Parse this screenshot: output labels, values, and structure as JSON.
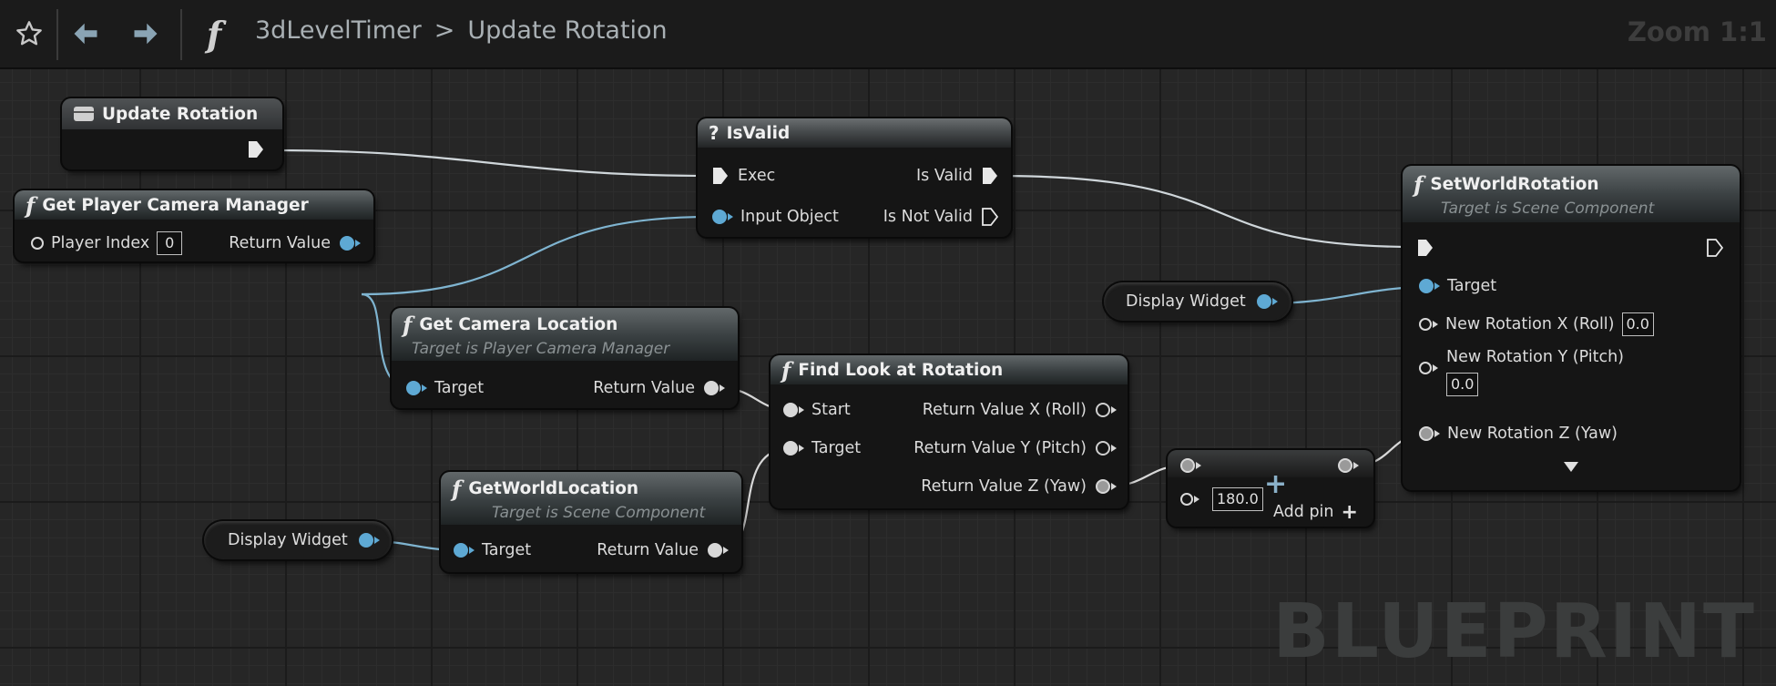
{
  "toolbar": {
    "star_icon": "star-icon",
    "back_icon": "back-arrow-icon",
    "forward_icon": "forward-arrow-icon",
    "function_icon_glyph": "f",
    "breadcrumb_parent": "3dLevelTimer",
    "breadcrumb_separator": ">",
    "breadcrumb_current": "Update Rotation",
    "zoom": "Zoom 1:1"
  },
  "watermark": "BLUEPRINT",
  "nodes": {
    "update_rotation": {
      "title": "Update Rotation"
    },
    "is_valid": {
      "title_glyph": "?",
      "title": "IsValid",
      "exec": "Exec",
      "input_object": "Input Object",
      "is_valid": "Is Valid",
      "is_not_valid": "Is Not Valid"
    },
    "get_player_camera_manager": {
      "title": "Get Player Camera Manager",
      "player_index": "Player Index",
      "player_index_value": "0",
      "return_value": "Return Value"
    },
    "get_camera_location": {
      "title": "Get Camera Location",
      "subtitle": "Target is Player Camera Manager",
      "target": "Target",
      "return_value": "Return Value"
    },
    "find_look_at_rotation": {
      "title": "Find Look at Rotation",
      "start": "Start",
      "target": "Target",
      "return_x": "Return Value X (Roll)",
      "return_y": "Return Value Y (Pitch)",
      "return_z": "Return Value Z (Yaw)"
    },
    "get_world_location": {
      "title": "GetWorldLocation",
      "subtitle": "Target is Scene Component",
      "target": "Target",
      "return_value": "Return Value"
    },
    "display_widget_1": {
      "label": "Display Widget"
    },
    "display_widget_2": {
      "label": "Display Widget"
    },
    "add_node": {
      "operator": "+",
      "value": "180.0",
      "add_pin": "Add pin",
      "add_pin_icon": "plus-icon"
    },
    "set_world_rotation": {
      "title": "SetWorldRotation",
      "subtitle": "Target is Scene Component",
      "target": "Target",
      "new_rot_x": "New Rotation X (Roll)",
      "new_rot_x_value": "0.0",
      "new_rot_y": "New Rotation Y (Pitch)",
      "new_rot_y_value": "0.0",
      "new_rot_z": "New Rotation Z (Yaw)",
      "expand_icon": "expand-arrow-icon"
    }
  },
  "colors": {
    "object_pin": "#5ea9d4",
    "wire_object": "#7fb4d0",
    "wire_exec": "#cfd6da",
    "wire_vector": "#d8d8d8"
  }
}
